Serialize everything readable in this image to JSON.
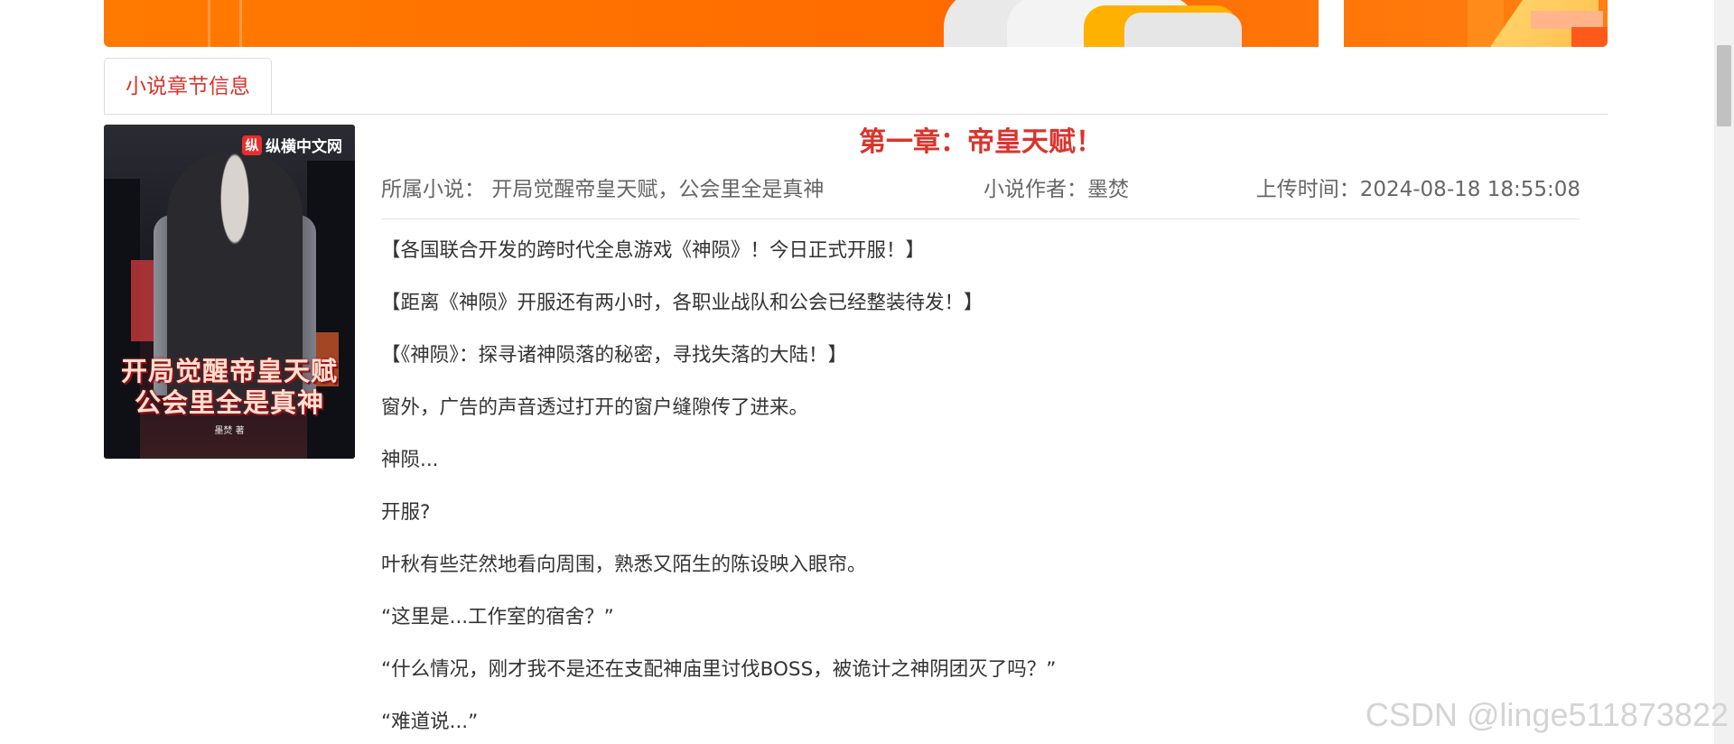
{
  "tab": {
    "label": "小说章节信息"
  },
  "cover": {
    "logo_text": "纵横中文网",
    "title_line1": "开局觉醒帝皇天赋",
    "title_line2": "公会里全是真神",
    "author_text": "墨焚 著"
  },
  "chapter": {
    "title": "第一章：帝皇天赋！",
    "novel_label": "所属小说：",
    "novel_value": "开局觉醒帝皇天赋，公会里全是真神",
    "author_label": "小说作者：",
    "author_value": "墨焚",
    "time_label": "上传时间：",
    "time_value": "2024-08-18 18:55:08",
    "paragraphs": [
      "【各国联合开发的跨时代全息游戏《神陨》！今日正式开服！】",
      "【距离《神陨》开服还有两小时，各职业战队和公会已经整装待发！】",
      "【《神陨》：探寻诸神陨落的秘密，寻找失落的大陆！】",
      "窗外，广告的声音透过打开的窗户缝隙传了进来。",
      "神陨...",
      "开服?",
      "叶秋有些茫然地看向周围，熟悉又陌生的陈设映入眼帘。",
      "“这里是...工作室的宿舍？”",
      "“什么情况，刚才我不是还在支配神庙里讨伐BOSS，被诡计之神阴团灭了吗？”",
      "“难道说...”"
    ]
  },
  "watermark": "CSDN @linge511873822",
  "colors": {
    "accent_red": "#d9342b",
    "banner_orange": "#ff6a00"
  }
}
